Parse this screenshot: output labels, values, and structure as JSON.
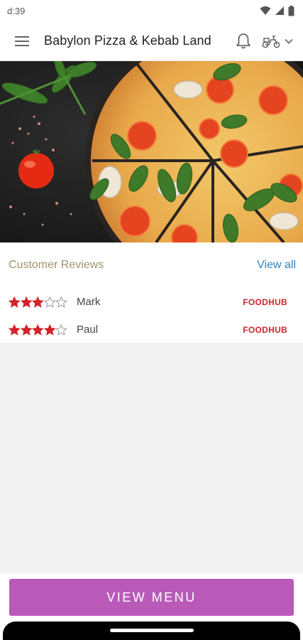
{
  "status_bar": {
    "time": "d:39",
    "icons": [
      "wifi-icon",
      "signal-icon",
      "battery-icon"
    ]
  },
  "app_bar": {
    "title": "Babylon Pizza & Kebab Land",
    "icons": [
      "hamburger-menu-icon",
      "bell-icon",
      "delivery-scooter-icon",
      "chevron-down-icon"
    ]
  },
  "hero": {
    "description_icon": "pizza-image"
  },
  "reviews": {
    "title": "Customer Reviews",
    "view_all": "View all",
    "items": [
      {
        "name": "Mark",
        "rating": 3,
        "max_rating": 5,
        "source": "FOODHUB"
      },
      {
        "name": "Paul",
        "rating": 4,
        "max_rating": 5,
        "source": "FOODHUB"
      }
    ]
  },
  "footer": {
    "button_label": "VIEW MENU"
  },
  "colors": {
    "accent_purple": "#b95ab9",
    "star_red": "#d2232a",
    "link_blue": "#2a86c8",
    "reviews_title": "#a0936b"
  }
}
